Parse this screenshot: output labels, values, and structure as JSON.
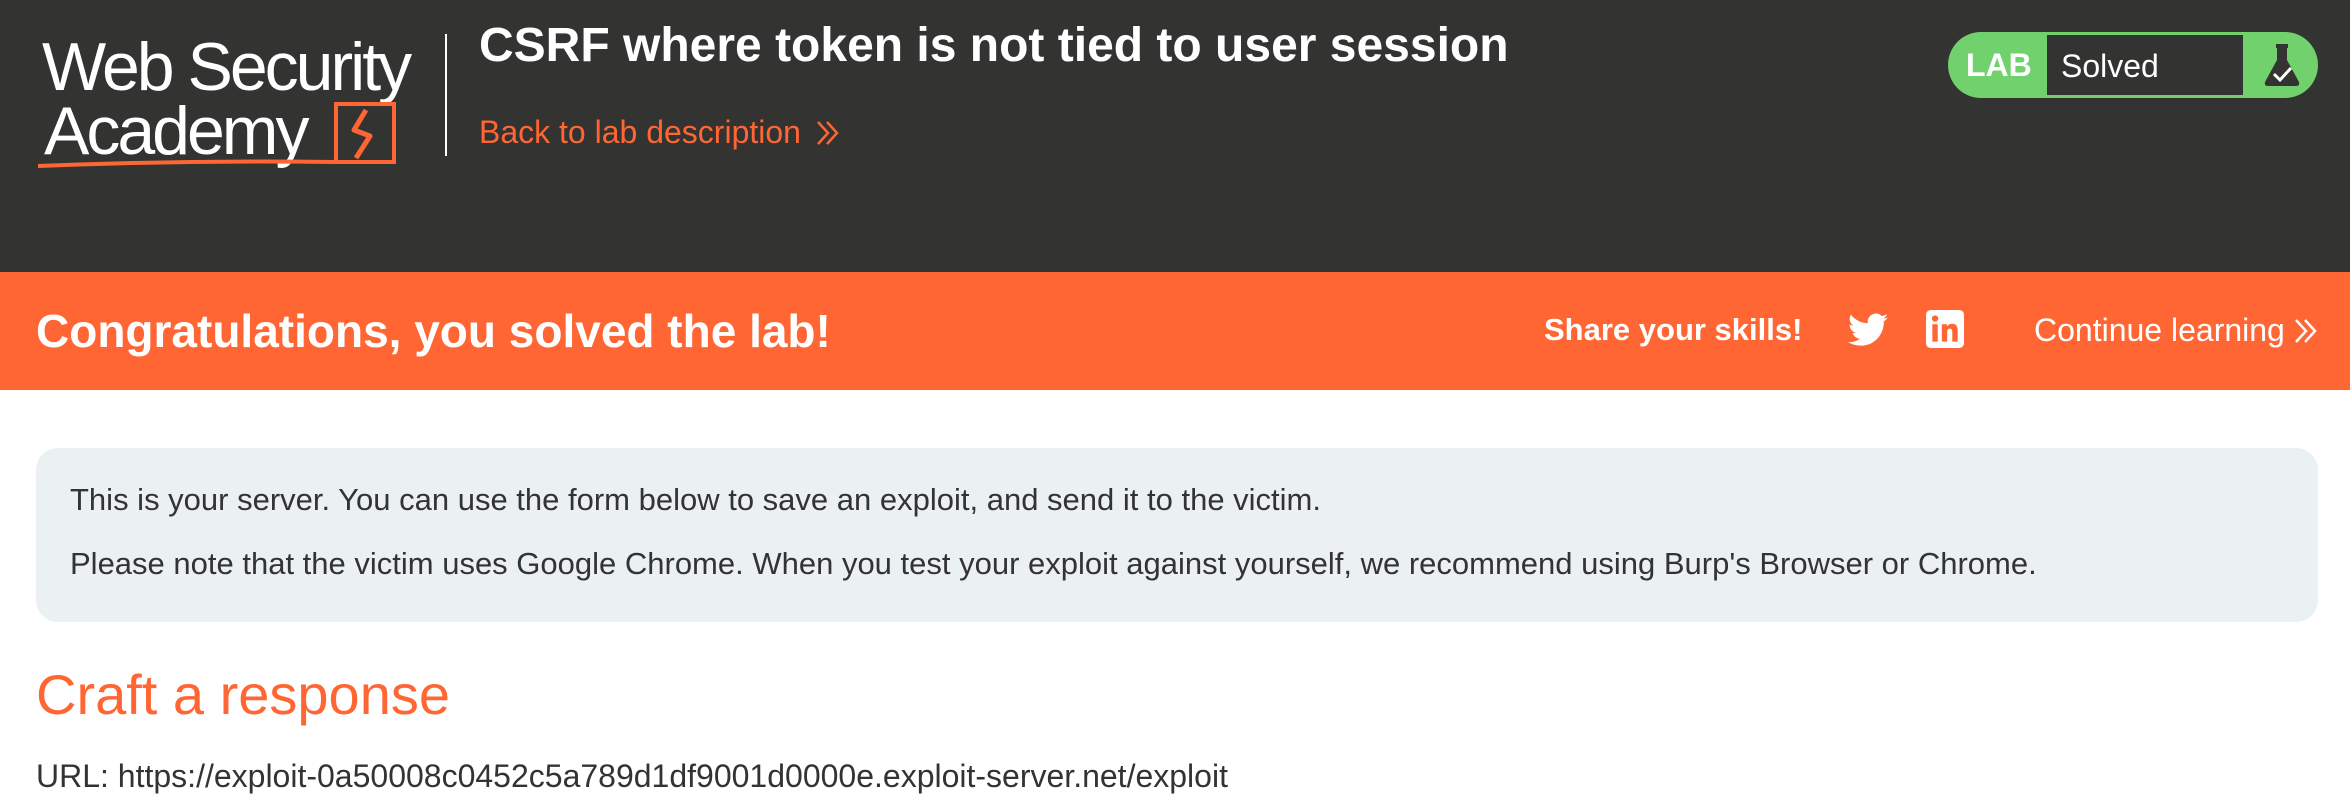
{
  "header": {
    "logo_line1": "Web Security",
    "logo_line2": "Academy",
    "lab_title": "CSRF where token is not tied to user session",
    "back_link": "Back to lab description",
    "lab_tag": "LAB",
    "lab_status": "Solved",
    "icons": {
      "back": "double-chevron-right-icon",
      "status": "flask-check-icon"
    }
  },
  "banner": {
    "message": "Congratulations, you solved the lab!",
    "share_label": "Share your skills!",
    "continue_label": "Continue learning",
    "icons": {
      "twitter": "twitter-icon",
      "linkedin": "linkedin-icon",
      "continue": "double-chevron-right-icon"
    }
  },
  "info": {
    "line1": "This is your server. You can use the form below to save an exploit, and send it to the victim.",
    "line2": "Please note that the victim uses Google Chrome. When you test your exploit against yourself, we recommend using Burp's Browser or Chrome."
  },
  "craft": {
    "heading": "Craft a response",
    "url_line": "URL: https://exploit-0a50008c0452c5a789d1df9001d0000e.exploit-server.net/exploit"
  },
  "colors": {
    "header_bg": "#333332",
    "accent_orange": "#ff6633",
    "solved_green": "#70d16d",
    "info_bg": "#ebf0f2"
  }
}
